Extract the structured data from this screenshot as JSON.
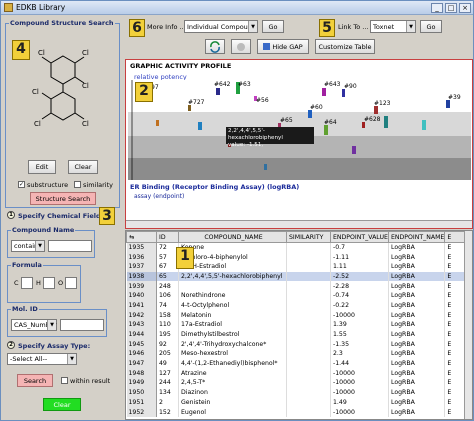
{
  "window": {
    "title": "EDKB Library"
  },
  "structure_search": {
    "title": "Compound Structure Search",
    "badge": "4",
    "edit_label": "Edit",
    "clear_label": "Clear",
    "substructure_label": "substructure",
    "similarity_label": "similarity",
    "search_label": "Structure Search",
    "atom_labels": [
      "Cl",
      "Cl",
      "Cl",
      "Cl",
      "Cl",
      "Cl"
    ]
  },
  "chemical_fields": {
    "step": "1",
    "title": "Specify Chemical Fields:",
    "badge": "3",
    "compound_name": {
      "title": "Compound Name",
      "operator": "contains"
    },
    "formula": {
      "title": "Formula",
      "c": "C",
      "h": "H",
      "o": "O"
    },
    "mol_id": {
      "title": "Mol. ID",
      "field": "CAS_Number"
    }
  },
  "assay": {
    "step": "2",
    "title": "Specify Assay Type:",
    "select": "-Select All--",
    "search_label": "Search",
    "within_label": "within result",
    "clear_label": "Clear"
  },
  "toolbar": {
    "more_info_badge": "6",
    "more_info_label": "More Info ...",
    "more_info_value": "Individual Compound",
    "go_label": "Go",
    "link_badge": "5",
    "link_label": "Link To ...",
    "link_value": "Toxnet",
    "hide_gap_label": "Hide GAP",
    "customize_label": "Customize Table"
  },
  "graph": {
    "title": "GRAPHIC ACTIVITY PROFILE",
    "ylabel": "relative potency",
    "badge": "2",
    "tooltip_line1": "2,2',4,4',5,5'-hexachlorobiphenyl",
    "tooltip_line2": "value: -1.51,",
    "footer": "ER Binding (Receptor Binding Assay) (logRBA)",
    "subfooter": "assay (endpoint)",
    "point_labels": [
      "#97",
      "#642",
      "#63",
      "#643",
      "#90",
      "#727",
      "#56",
      "#60",
      "#123",
      "#65",
      "#628",
      "#64",
      "#39"
    ]
  },
  "table": {
    "badge": "1",
    "columns": [
      "ID",
      "COMPOUND_NAME",
      "SIMILARITY",
      "ENDPOINT_VALUE",
      "ENDPOINT_NAME",
      "E"
    ],
    "rows": [
      [
        "1935",
        "72",
        "Kepone",
        "",
        "-0.7",
        "LogRBA",
        "E"
      ],
      [
        "1936",
        "57",
        "2-Chloro-4-biphenylol",
        "",
        "-1.11",
        "LogRBA",
        "E"
      ],
      [
        "1937",
        "67",
        "4-OH-Estradiol",
        "",
        "1.11",
        "LogRBA",
        "E"
      ],
      [
        "1938",
        "65",
        "2,2',4,4',5,5'-hexachlorobiphenyl",
        "",
        "-2.52",
        "LogRBA",
        "E"
      ],
      [
        "1939",
        "248",
        "",
        "",
        "-2.28",
        "LogRBA",
        "E"
      ],
      [
        "1940",
        "106",
        "Norethindrone",
        "",
        "-0.74",
        "LogRBA",
        "E"
      ],
      [
        "1941",
        "74",
        "4-t-Octylphenol",
        "",
        "-0.22",
        "LogRBA",
        "E"
      ],
      [
        "1942",
        "158",
        "Melatonin",
        "",
        "-10000",
        "LogRBA",
        "E"
      ],
      [
        "1943",
        "110",
        "17a-Estradiol",
        "",
        "1.39",
        "LogRBA",
        "E"
      ],
      [
        "1944",
        "195",
        "Dimethylstilbestrol",
        "",
        "1.55",
        "LogRBA",
        "E"
      ],
      [
        "1945",
        "92",
        "2',4',4'-Trihydroxychalcone*",
        "",
        "-1.35",
        "LogRBA",
        "E"
      ],
      [
        "1946",
        "205",
        "Meso-hexestrol",
        "",
        "2.3",
        "LogRBA",
        "E"
      ],
      [
        "1947",
        "49",
        "4,4'-(1,2-Ethanediyl)bisphenol*",
        "",
        "-1.44",
        "LogRBA",
        "E"
      ],
      [
        "1948",
        "127",
        "Atrazine",
        "",
        "-10000",
        "LogRBA",
        "E"
      ],
      [
        "1949",
        "244",
        "2,4,5-T*",
        "",
        "-10000",
        "LogRBA",
        "E"
      ],
      [
        "1950",
        "134",
        "Diazinon",
        "",
        "-10000",
        "LogRBA",
        "E"
      ],
      [
        "1951",
        "2",
        "Genistein",
        "",
        "1.49",
        "LogRBA",
        "E"
      ],
      [
        "1952",
        "152",
        "Eugenol",
        "",
        "-10000",
        "LogRBA",
        "E"
      ]
    ]
  },
  "colors": {
    "badge": "#f2d03a",
    "pink_button": "#f5b4b4",
    "green_button": "#22dd22",
    "group_border": "#6a8fc7"
  }
}
